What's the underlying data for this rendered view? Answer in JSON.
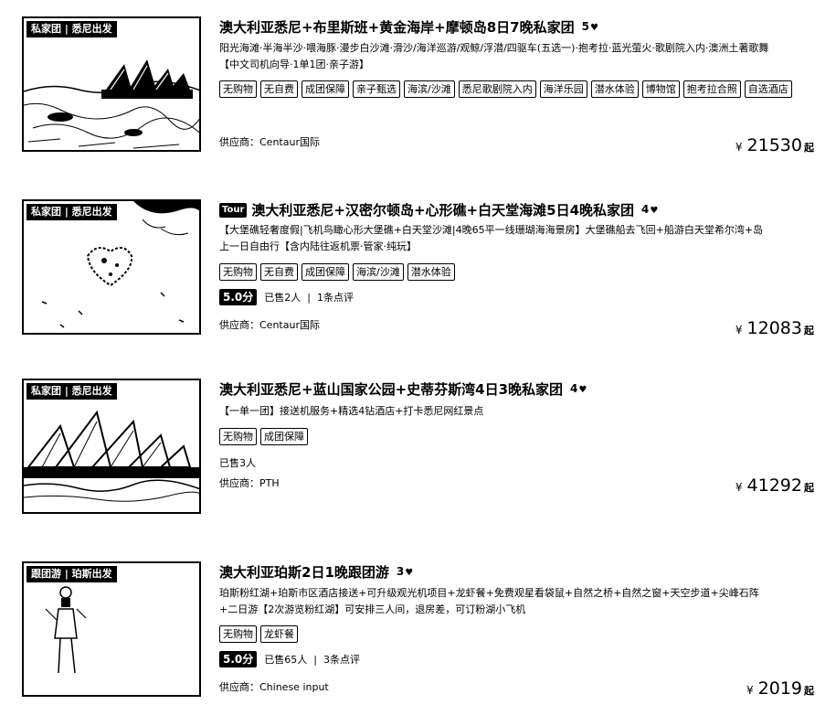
{
  "products": [
    {
      "thumb_tag": "私家团 | 悉尼出发",
      "brand": "",
      "title": "澳大利亚悉尼+布里斯班+黄金海岸+摩顿岛8日7晚私家团",
      "level": "5",
      "desc_lines": [
        "阳光海滩·半海半沙·喂海豚·漫步白沙滩·滑沙/海洋巡游/观鲸/浮潜/四驱车(五选一)·抱考拉·蓝光萤火·歌剧院入内·澳洲土著歌舞",
        "【中文司机向导·1单1团·亲子游】"
      ],
      "tags": [
        "无购物",
        "无自费",
        "成团保障",
        "亲子甄选",
        "海滨/沙滩",
        "悉尼歌剧院入内",
        "海洋乐园",
        "潜水体验",
        "博物馆",
        "抱考拉合照",
        "自选酒店"
      ],
      "score": "",
      "sold": "",
      "reviews": "",
      "supplier": "供应商：Centaur国际",
      "currency": "¥",
      "price": "21530",
      "price_suffix": "起"
    },
    {
      "thumb_tag": "私家团 | 悉尼出发",
      "brand": "Tour",
      "title": "澳大利亚悉尼+汉密尔顿岛+心形礁+白天堂海滩5日4晚私家团",
      "level": "4",
      "desc_lines": [
        "【大堡礁轻奢度假|飞机鸟瞰心形大堡礁+白天堂沙滩|4晚65平一线珊瑚海海景房】大堡礁船去飞回+船游白天堂希尔湾+岛",
        "上一日自由行【含内陆往返机票·管家·纯玩】"
      ],
      "tags": [
        "无购物",
        "无自费",
        "成团保障",
        "海滨/沙滩",
        "潜水体验"
      ],
      "score": "5.0分",
      "sold": "已售2人",
      "reviews": "1条点评",
      "supplier": "供应商：Centaur国际",
      "currency": "¥",
      "price": "12083",
      "price_suffix": "起"
    },
    {
      "thumb_tag": "私家团 | 悉尼出发",
      "brand": "",
      "title": "澳大利亚悉尼+蓝山国家公园+史蒂芬斯湾4日3晚私家团",
      "level": "4",
      "desc_lines": [
        "【一单一团】接送机服务+精选4钻酒店+打卡悉尼网红景点"
      ],
      "tags": [
        "无购物",
        "成团保障"
      ],
      "score": "",
      "sold": "已售3人",
      "reviews": "",
      "supplier": "供应商：PTH",
      "currency": "¥",
      "price": "41292",
      "price_suffix": "起"
    },
    {
      "thumb_tag": "跟团游 | 珀斯出发",
      "brand": "",
      "title": "澳大利亚珀斯2日1晚跟团游",
      "level": "3",
      "desc_lines": [
        "珀斯粉红湖+珀斯市区酒店接送+可升级观光机项目+龙虾餐+免费观星看袋鼠+自然之桥+自然之窗+天空步道+尖峰石阵",
        "+二日游【2次游览粉红湖】可安排三人间，退房差，可订粉湖小飞机"
      ],
      "tags": [
        "无购物",
        "龙虾餐"
      ],
      "score": "5.0分",
      "sold": "已售65人",
      "reviews": "3条点评",
      "supplier": "供应商：Chinese input",
      "currency": "¥",
      "price": "2019",
      "price_suffix": "起"
    }
  ],
  "icons": {
    "level": "heart-icon"
  },
  "colors": {
    "ink": "#000000",
    "paper": "#ffffff"
  }
}
